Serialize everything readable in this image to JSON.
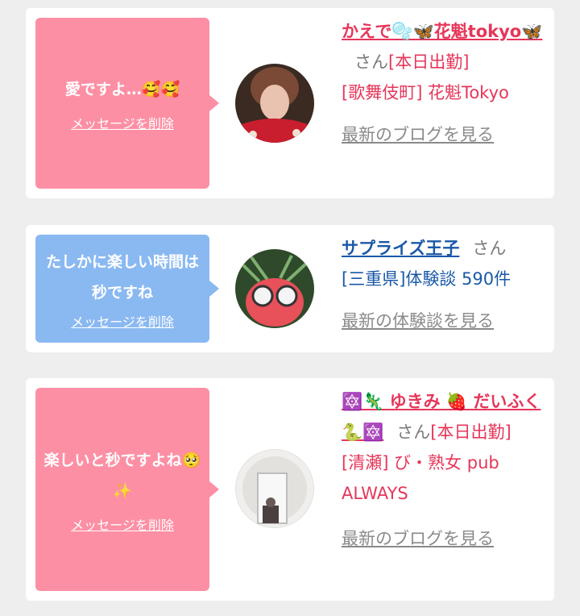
{
  "cards": [
    {
      "message": "愛ですよ…🥰🥰",
      "delete_label": "メッセージを削除",
      "name": "かえで🫧🦋花魁tokyo🦋",
      "san": "さん",
      "tag": "[本日出勤]",
      "shop": "[歌舞伎町] 花魁Tokyo",
      "link": "最新のブログを見る"
    },
    {
      "message": "たしかに楽しい時間は秒ですね",
      "delete_label": "メッセージを削除",
      "name": "サプライズ王子",
      "san": "さん",
      "detail": "[三重県]体験談 590件",
      "link": "最新の体験談を見る"
    },
    {
      "message": "楽しいと秒ですよね🥺✨",
      "delete_label": "メッセージを削除",
      "name": "🔯🦎 ゆきみ 🍓 だいふく 🐍🔯",
      "san": "さん",
      "tag": "[本日出勤]",
      "shop": "[清瀬] び・熟女 pub ALWAYS",
      "link": "最新のブログを見る"
    }
  ],
  "colors": {
    "background": "#eeeeef",
    "pink_bubble": "#fd8fa4",
    "blue_bubble": "#8ab9f2",
    "pink_text": "#e6365a",
    "blue_text": "#1a59a8"
  }
}
